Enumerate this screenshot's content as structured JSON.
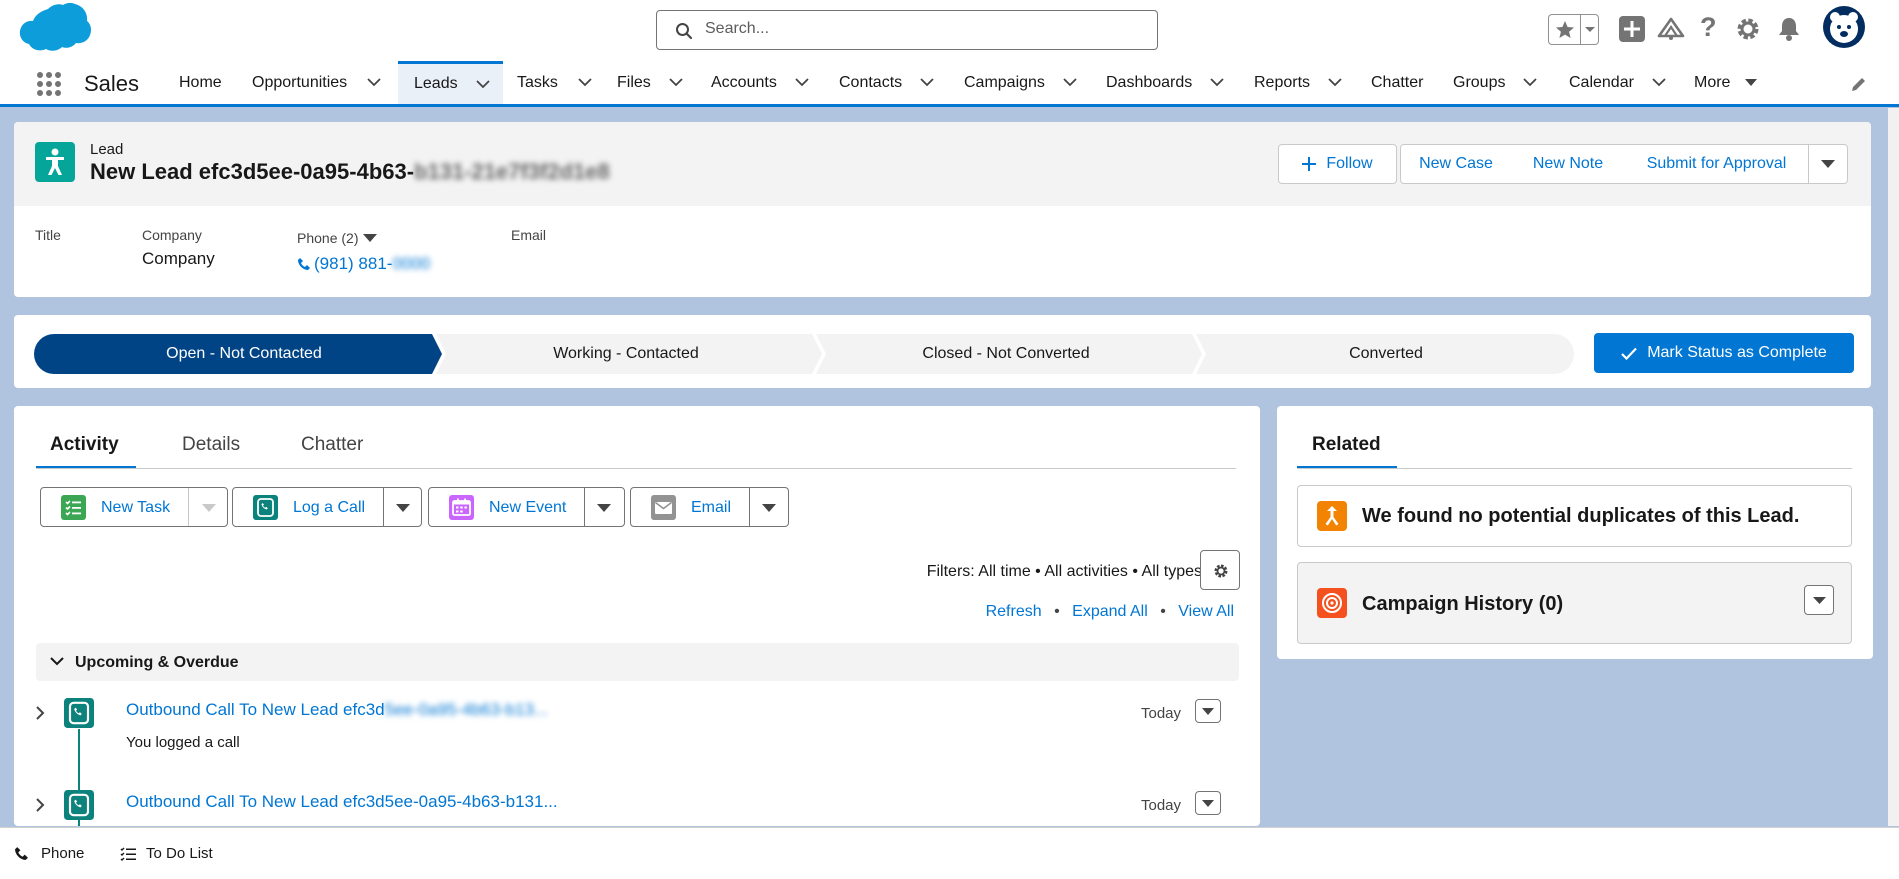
{
  "global_header": {
    "search_placeholder": "Search...",
    "icons": [
      "salesforce-logo",
      "favorites-star-icon",
      "chevron-down-icon",
      "add-icon",
      "trailhead-icon",
      "help-icon",
      "gear-icon",
      "bell-icon",
      "avatar"
    ]
  },
  "nav": {
    "app_name": "Sales",
    "items": [
      {
        "label": "Home",
        "chevron": false
      },
      {
        "label": "Opportunities",
        "chevron": true
      },
      {
        "label": "Leads",
        "chevron": true,
        "active": true
      },
      {
        "label": "Tasks",
        "chevron": true
      },
      {
        "label": "Files",
        "chevron": true
      },
      {
        "label": "Accounts",
        "chevron": true
      },
      {
        "label": "Contacts",
        "chevron": true
      },
      {
        "label": "Campaigns",
        "chevron": true
      },
      {
        "label": "Dashboards",
        "chevron": true
      },
      {
        "label": "Reports",
        "chevron": true
      },
      {
        "label": "Chatter",
        "chevron": false
      },
      {
        "label": "Groups",
        "chevron": true
      },
      {
        "label": "Calendar",
        "chevron": true
      },
      {
        "label": "More",
        "chevron": true
      }
    ]
  },
  "record": {
    "object_label": "Lead",
    "title": "New Lead efc3d5ee-0a95-4b63-",
    "title_blurred": "b131-21e7f3f2d1e8",
    "actions": {
      "follow": "Follow",
      "new_case": "New Case",
      "new_note": "New Note",
      "submit": "Submit for Approval"
    },
    "fields": {
      "title_label": "Title",
      "company_label": "Company",
      "company_value": "Company",
      "phone_label": "Phone (2)",
      "phone_value": "(981) 881-",
      "phone_blurred": "0000",
      "email_label": "Email"
    }
  },
  "path": {
    "steps": [
      "Open - Not Contacted",
      "Working - Contacted",
      "Closed - Not Converted",
      "Converted"
    ],
    "current_step": 0,
    "mark_complete_label": "Mark Status as Complete",
    "colors": {
      "current": "#014486",
      "inactive": "#f3f3f3",
      "button": "#0176d3"
    }
  },
  "activity": {
    "tabs": [
      "Activity",
      "Details",
      "Chatter"
    ],
    "active_tab": "Activity",
    "buttons": {
      "new_task": "New Task",
      "log_call": "Log a Call",
      "new_event": "New Event",
      "email": "Email"
    },
    "filters_text": "Filters: All time • All activities • All types",
    "links": {
      "refresh": "Refresh",
      "expand_all": "Expand All",
      "view_all": "View All",
      "separator": "•"
    },
    "section_title": "Upcoming & Overdue",
    "items": [
      {
        "title": "Outbound Call To New Lead efc3d",
        "title_blurred": "5ee-0a95-4b63-b13...",
        "subtitle": "You logged a call",
        "date": "Today"
      },
      {
        "title": "Outbound Call To New Lead efc3d5ee-0a95-4b63-b131...",
        "title_blurred": "",
        "subtitle": "",
        "date": "Today"
      }
    ],
    "colors": {
      "task": "#3ba755",
      "call": "#0b827c",
      "event": "#cb65ff",
      "email": "#939393"
    }
  },
  "related": {
    "tab": "Related",
    "duplicates_text": "We found no potential duplicates of this Lead.",
    "campaign_history": "Campaign History (0)",
    "colors": {
      "duplicates": "#f38303",
      "campaign": "#f4511e"
    }
  },
  "utility_bar": {
    "phone": "Phone",
    "todo": "To Do List"
  }
}
